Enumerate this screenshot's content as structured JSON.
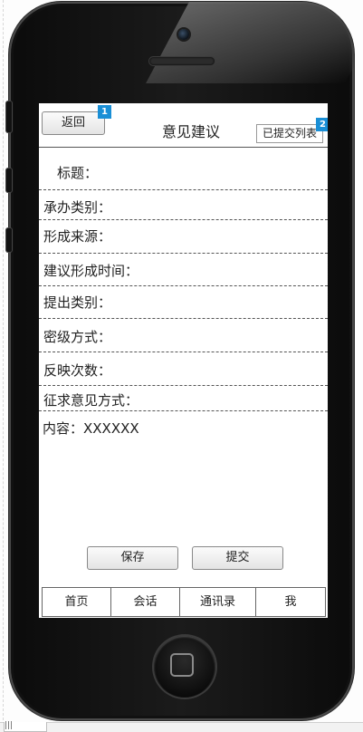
{
  "header": {
    "back_label": "返回",
    "title": "意见建议",
    "submitted_list_label": "已提交列表",
    "badge_back": "1",
    "badge_list": "2"
  },
  "form": {
    "fields": [
      "标题：",
      "承办类别：",
      "形成来源：",
      "建议形成时间：",
      "提出类别：",
      "密级方式：",
      "反映次数：",
      "征求意见方式："
    ],
    "content": "内容：XXXXXX"
  },
  "actions": {
    "save": "保存",
    "submit": "提交"
  },
  "tabbar": [
    "首页",
    "会话",
    "通讯录",
    "我"
  ],
  "footer_tab_label": "|||"
}
